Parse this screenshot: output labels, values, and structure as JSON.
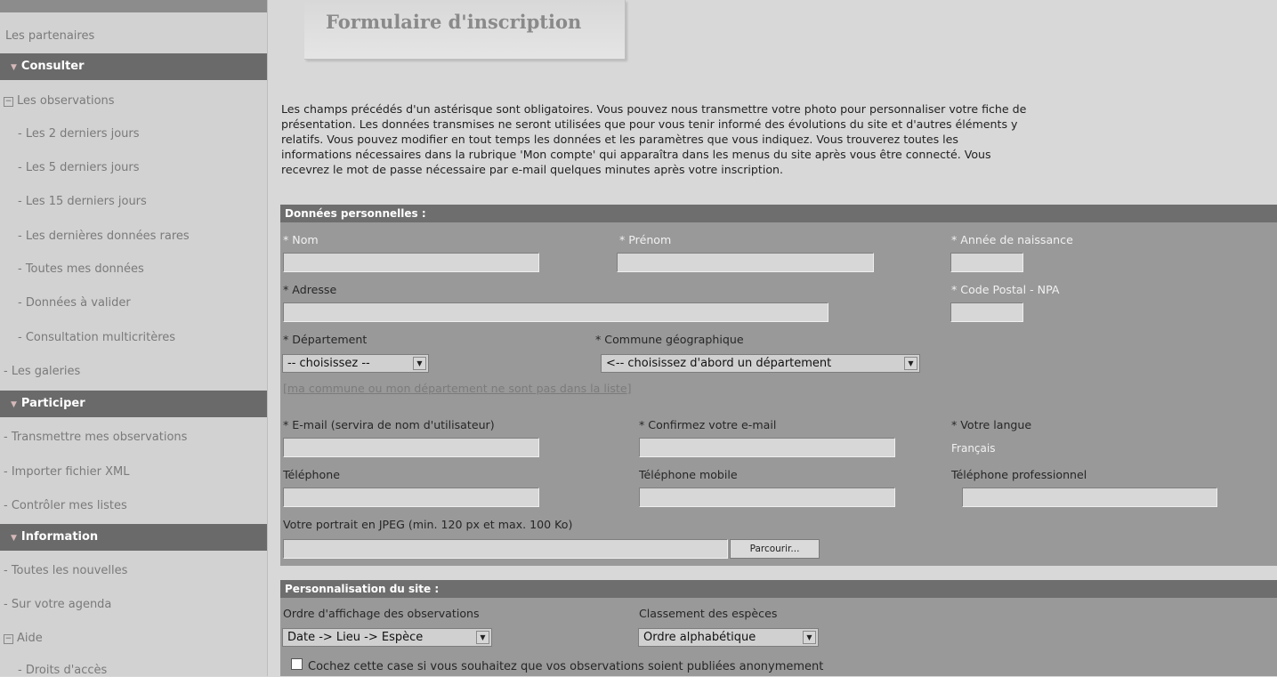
{
  "sidebar": {
    "partners": "Les partenaires",
    "consult_header": "Consulter",
    "observations": "Les observations",
    "obs_items": [
      "- Les 2 derniers jours",
      "- Les 5 derniers jours",
      "- Les 15 derniers jours",
      "- Les dernières données rares",
      "- Toutes mes données",
      "- Données à valider",
      "- Consultation multicritères"
    ],
    "galleries": "- Les galeries",
    "participate_header": "Participer",
    "participate_items": [
      "- Transmettre mes observations",
      "- Importer fichier XML",
      "- Contrôler mes listes"
    ],
    "information_header": "Information",
    "information_items": [
      "- Toutes les nouvelles",
      "- Sur votre agenda"
    ],
    "help": "Aide",
    "help_items": [
      "- Droits d'accès"
    ],
    "expand_symbol": "⊟",
    "header_symbol": "▼"
  },
  "page": {
    "title": "Formulaire d'inscription",
    "intro_lines": [
      "Les champs précédés d'un astérisque sont obligatoires. Vous pouvez nous transmettre votre photo pour personnaliser votre fiche de",
      "présentation. Les données transmises ne seront utilisées que pour vous tenir informé des évolutions du site et d'autres éléments y",
      "relatifs. Vous pouvez modifier en tout temps les données et les paramètres que vous indiquez. Vous trouverez toutes les",
      "informations nécessaires dans la rubrique 'Mon compte' qui apparaîtra dans les menus du site après vous être connecté. Vous",
      "recevrez le mot de passe nécessaire par e-mail quelques minutes après votre inscription."
    ]
  },
  "personal": {
    "header": "Données personnelles :",
    "nom_label": "* Nom",
    "prenom_label": "* Prénom",
    "annee_label": "* Année de naissance",
    "adresse_label": "* Adresse",
    "code_postal_label": "* Code Postal - NPA",
    "departement_label": "* Département",
    "commune_label": "* Commune géographique",
    "departement_value": "-- choisissez --",
    "commune_value": "<-- choisissez d'abord un département",
    "missing_link": "[ma commune ou mon département ne sont pas dans la liste]",
    "email_label": "* E-mail (servira de nom d'utilisateur)",
    "confirm_email_label": "* Confirmez votre e-mail",
    "langue_label": "* Votre langue",
    "langue_value": "Français",
    "telephone_label": "Téléphone",
    "mobile_label": "Téléphone mobile",
    "pro_label": "Téléphone professionnel",
    "portrait_label": "Votre portrait en JPEG (min. 120 px et max. 100 Ko)",
    "browse_button": "Parcourir..."
  },
  "custom": {
    "header": "Personnalisation du site :",
    "order_label": "Ordre d'affichage des observations",
    "order_value": "Date -> Lieu -> Espèce",
    "species_label": "Classement des espèces",
    "species_value": "Ordre alphabétique",
    "anonymous_label": "Cochez cette case si vous souhaitez que vos observations soient publiées anonymement"
  },
  "icons": {
    "dropdown": "▼"
  }
}
